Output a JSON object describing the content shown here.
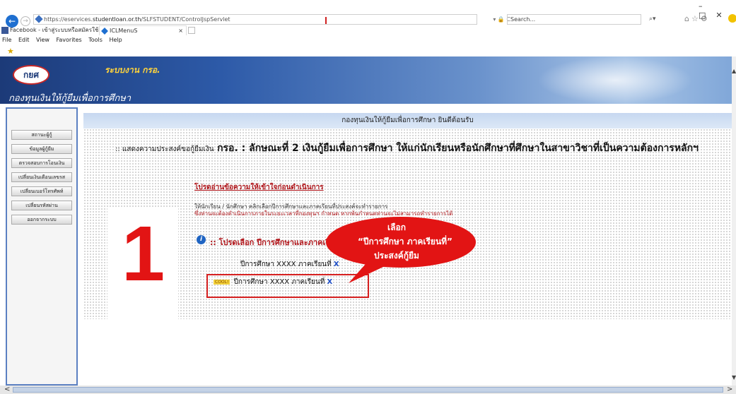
{
  "browser": {
    "url_prefix": "https://eservices.",
    "url_domain": "studentloan.or.th",
    "url_path": "/SLFSTUDENT/ControlJspServlet",
    "address_controls": "▾ 🔒 C",
    "search_placeholder": "Search...",
    "search_go": "⌕▾",
    "toolbar_icons": "⌂☆⚙",
    "window_buttons": "–□✕",
    "tabs": [
      {
        "label": "Facebook - เข้าสู่ระบบหรือสมัครใช้..."
      },
      {
        "label": "ICLMenuS",
        "close": "×"
      }
    ],
    "menu": [
      "File",
      "Edit",
      "View",
      "Favorites",
      "Tools",
      "Help"
    ]
  },
  "banner": {
    "logo_text": "กยศ",
    "subtitle": "ระบบงาน กรอ.",
    "title": "กองทุนเงินให้กู้ยืมเพื่อการศึกษา"
  },
  "sidebar": {
    "items": [
      "สถานะผู้กู้",
      "ข้อมูลผู้กู้ยืม",
      "ตรวจสอบการโอนเงิน",
      "เปลี่ยนเงินเดือนเลขรส",
      "เปลี่ยนเบอร์โทรศัพท์",
      "เปลี่ยนรหัสผ่าน",
      "ออกจากระบบ"
    ]
  },
  "main": {
    "welcome": "กองทุนเงินให้กู้ยืมเพื่อการศึกษา ยินดีต้อนรับ",
    "heading_lead": ":: แสดงความประสงค์ขอกู้ยืมเงิน",
    "heading_bold": "กรอ. : ลักษณะที่ 2 เงินกู้ยืมเพื่อการศึกษา ให้แก่นักเรียนหรือนักศึกษาที่ศึกษาในสาขาวิชาที่เป็นความต้องการหลักฯ",
    "notice_link": "โปรดอ่านข้อความให้เข้าใจก่อนดำเนินการ",
    "instruction_1": "ให้นักเรียน / นักศึกษา คลิกเลือกปีการศึกษาและภาคเรียนที่ประสงค์จะทำรายการ",
    "instruction_2": "ซึ่งท่านจะต้องดำเนินการภายในระยะเวลาที่กองทุนฯ กำหนด หากพ้นกำหนดท่านจะไม่สามารถทำรายการได้",
    "info_icon": "i",
    "select_prompt": ":: โปรดเลือก ปีการศึกษาและภาคเรียน",
    "step_number": "1",
    "term_row_1": {
      "text": "ปีการศึกษา XXXX ภาคเรียนที่",
      "term": "X"
    },
    "term_row_2": {
      "badge": "COOL!",
      "text": "ปีการศึกษา XXXX ภาคเรียนที่",
      "term": "X"
    }
  },
  "callout": {
    "line_1": "เลือก",
    "line_2": "“ปีการศึกษา  ภาคเรียนที่”",
    "line_3": "ประสงค์กู้ยืม",
    "color": "#e21414"
  },
  "scroll": {
    "up": "▲",
    "down": "▼",
    "left": "<",
    "right": ">"
  }
}
